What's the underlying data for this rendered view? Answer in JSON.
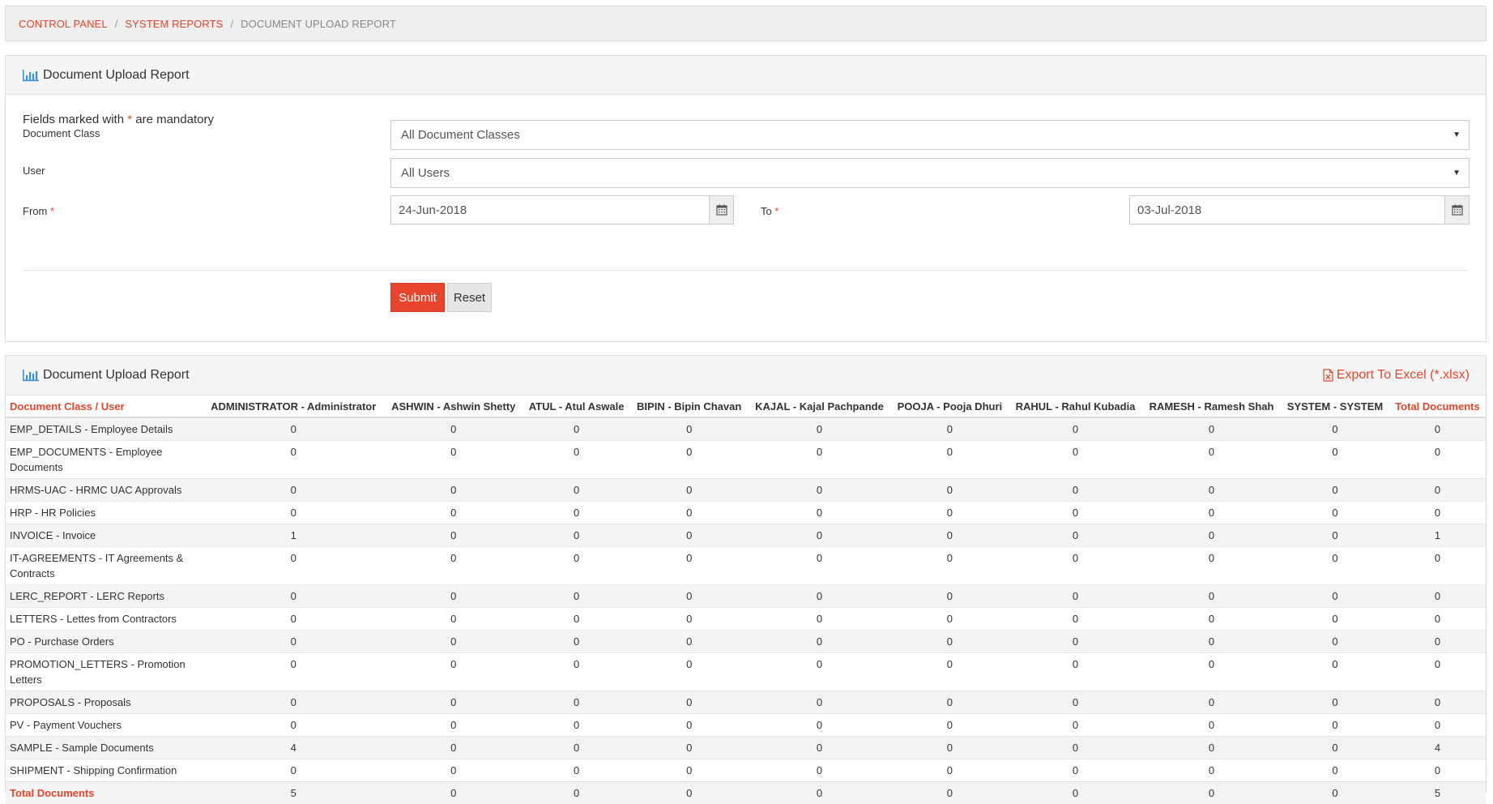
{
  "breadcrumb": {
    "items": [
      "CONTROL PANEL",
      "SYSTEM REPORTS"
    ],
    "current": "DOCUMENT UPLOAD REPORT",
    "separator": "/"
  },
  "filter_panel": {
    "title": "Document Upload Report",
    "mandatory_note_prefix": "Fields marked with ",
    "mandatory_star": "*",
    "mandatory_note_suffix": " are mandatory",
    "document_class_label": "Document Class",
    "document_class_value": "All Document Classes",
    "user_label": "User",
    "user_value": "All Users",
    "from_label": "From",
    "from_value": "24-Jun-2018",
    "to_label": "To",
    "to_value": "03-Jul-2018",
    "submit_label": "Submit",
    "reset_label": "Reset"
  },
  "report_panel": {
    "title": "Document Upload Report",
    "export_label": "Export To Excel (*.xlsx)"
  },
  "table": {
    "corner_header": "Document Class / User",
    "columns": [
      "ADMINISTRATOR - Administrator",
      "ASHWIN - Ashwin Shetty",
      "ATUL - Atul Aswale",
      "BIPIN - Bipin Chavan",
      "KAJAL - Kajal Pachpande",
      "POOJA - Pooja Dhuri",
      "RAHUL - Rahul Kubadia",
      "RAMESH - Ramesh Shah",
      "SYSTEM - SYSTEM"
    ],
    "total_header": "Total Documents",
    "rows": [
      {
        "label": "EMP_DETAILS - Employee Details",
        "values": [
          "0",
          "0",
          "0",
          "0",
          "0",
          "0",
          "0",
          "0",
          "0"
        ],
        "total": "0"
      },
      {
        "label": "EMP_DOCUMENTS - Employee Documents",
        "values": [
          "0",
          "0",
          "0",
          "0",
          "0",
          "0",
          "0",
          "0",
          "0"
        ],
        "total": "0"
      },
      {
        "label": "HRMS-UAC - HRMC UAC Approvals",
        "values": [
          "0",
          "0",
          "0",
          "0",
          "0",
          "0",
          "0",
          "0",
          "0"
        ],
        "total": "0"
      },
      {
        "label": "HRP - HR Policies",
        "values": [
          "0",
          "0",
          "0",
          "0",
          "0",
          "0",
          "0",
          "0",
          "0"
        ],
        "total": "0"
      },
      {
        "label": "INVOICE - Invoice",
        "values": [
          "1",
          "0",
          "0",
          "0",
          "0",
          "0",
          "0",
          "0",
          "0"
        ],
        "total": "1"
      },
      {
        "label": "IT-AGREEMENTS - IT Agreements & Contracts",
        "values": [
          "0",
          "0",
          "0",
          "0",
          "0",
          "0",
          "0",
          "0",
          "0"
        ],
        "total": "0"
      },
      {
        "label": "LERC_REPORT - LERC Reports",
        "values": [
          "0",
          "0",
          "0",
          "0",
          "0",
          "0",
          "0",
          "0",
          "0"
        ],
        "total": "0"
      },
      {
        "label": "LETTERS - Lettes from Contractors",
        "values": [
          "0",
          "0",
          "0",
          "0",
          "0",
          "0",
          "0",
          "0",
          "0"
        ],
        "total": "0"
      },
      {
        "label": "PO - Purchase Orders",
        "values": [
          "0",
          "0",
          "0",
          "0",
          "0",
          "0",
          "0",
          "0",
          "0"
        ],
        "total": "0"
      },
      {
        "label": "PROMOTION_LETTERS - Promotion Letters",
        "values": [
          "0",
          "0",
          "0",
          "0",
          "0",
          "0",
          "0",
          "0",
          "0"
        ],
        "total": "0"
      },
      {
        "label": "PROPOSALS - Proposals",
        "values": [
          "0",
          "0",
          "0",
          "0",
          "0",
          "0",
          "0",
          "0",
          "0"
        ],
        "total": "0"
      },
      {
        "label": "PV - Payment Vouchers",
        "values": [
          "0",
          "0",
          "0",
          "0",
          "0",
          "0",
          "0",
          "0",
          "0"
        ],
        "total": "0"
      },
      {
        "label": "SAMPLE - Sample Documents",
        "values": [
          "4",
          "0",
          "0",
          "0",
          "0",
          "0",
          "0",
          "0",
          "0"
        ],
        "total": "4"
      },
      {
        "label": "SHIPMENT - Shipping Confirmation",
        "values": [
          "0",
          "0",
          "0",
          "0",
          "0",
          "0",
          "0",
          "0",
          "0"
        ],
        "total": "0"
      }
    ],
    "footer": {
      "label": "Total Documents",
      "values": [
        "5",
        "0",
        "0",
        "0",
        "0",
        "0",
        "0",
        "0",
        "0"
      ],
      "total": "5"
    }
  },
  "colors": {
    "accent": "#e8452c",
    "icon_blue": "#3a8fd6",
    "panel_heading_bg": "#f5f5f5",
    "striped_row_bg": "#f4f4f4"
  },
  "icons": {
    "chart": "bar-chart-icon",
    "calendar": "calendar-icon",
    "caret": "caret-down-icon",
    "excel": "file-excel-icon"
  }
}
